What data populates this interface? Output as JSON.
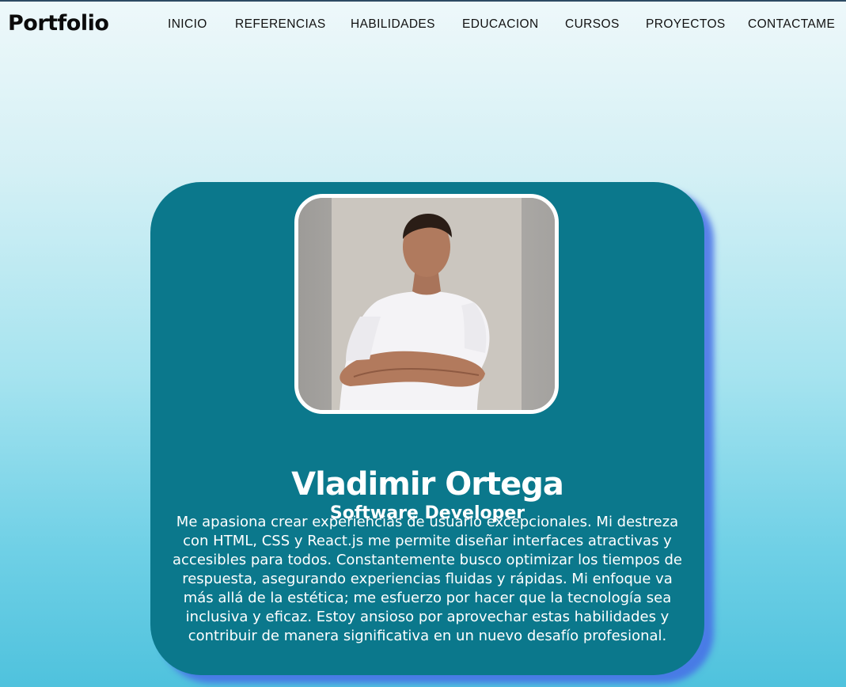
{
  "navbar": {
    "brand": "Portfolio",
    "links": [
      {
        "label": "INICIO"
      },
      {
        "label": "REFERENCIAS"
      },
      {
        "label": "HABILIDADES"
      },
      {
        "label": "EDUCACION"
      },
      {
        "label": "CURSOS"
      },
      {
        "label": "PROYECTOS"
      },
      {
        "label": "CONTACTAME"
      }
    ]
  },
  "profile": {
    "photo_icon": "profile-photo",
    "name": "Vladimir Ortega",
    "role": "Software Developer",
    "bio": "Me apasiona crear experiencias de usuario excepcionales. Mi destreza con HTML, CSS y React.js me permite diseñar interfaces atractivas y accesibles para todos. Constantemente busco optimizar los tiempos de respuesta, asegurando experiencias fluidas y rápidas. Mi enfoque va más allá de la estética; me esfuerzo por hacer que la tecnología sea inclusiva y eficaz. Estoy ansioso por aprovechar estas habilidades y contribuir de manera significativa en un nuevo desafío profesional."
  },
  "colors": {
    "card": "#0b788c",
    "card_shadow": "#466ee6",
    "text_on_card": "#ffffff",
    "nav_text": "#111111"
  }
}
